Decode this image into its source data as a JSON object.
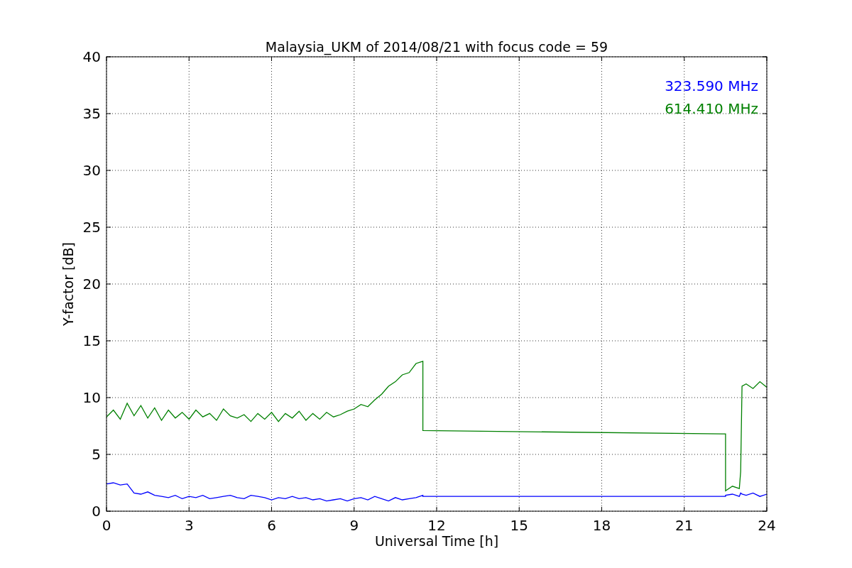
{
  "plot": {
    "chart_data": {
      "type": "line",
      "title": "Malaysia_UKM of 2014/08/21 with focus code = 59",
      "xlabel": "Universal Time [h]",
      "ylabel": "Y-factor [dB]",
      "x": [
        0,
        0.25,
        0.5,
        0.75,
        1,
        1.25,
        1.5,
        1.75,
        2,
        2.25,
        2.5,
        2.75,
        3,
        3.25,
        3.5,
        3.75,
        4,
        4.25,
        4.5,
        4.75,
        5,
        5.25,
        5.5,
        5.75,
        6,
        6.25,
        6.5,
        6.75,
        7,
        7.25,
        7.5,
        7.75,
        8,
        8.25,
        8.5,
        8.75,
        9,
        9.25,
        9.5,
        9.75,
        10,
        10.25,
        10.5,
        10.75,
        11,
        11.25,
        11.5,
        11.5,
        22.5,
        22.5,
        22.75,
        23,
        23.05,
        23.1,
        23.25,
        23.5,
        23.75,
        24
      ],
      "series": [
        {
          "name": "323.590 MHz",
          "color": "#0000ff",
          "values": [
            2.4,
            2.5,
            2.3,
            2.4,
            1.6,
            1.5,
            1.7,
            1.4,
            1.3,
            1.2,
            1.4,
            1.1,
            1.3,
            1.2,
            1.4,
            1.1,
            1.2,
            1.3,
            1.4,
            1.2,
            1.1,
            1.4,
            1.3,
            1.2,
            1.0,
            1.2,
            1.1,
            1.3,
            1.1,
            1.2,
            1.0,
            1.1,
            0.9,
            1.0,
            1.1,
            0.9,
            1.1,
            1.2,
            1.0,
            1.3,
            1.1,
            0.9,
            1.2,
            1.0,
            1.1,
            1.2,
            1.4,
            1.3,
            1.3,
            1.4,
            1.5,
            1.3,
            1.6,
            1.5,
            1.4,
            1.6,
            1.3,
            1.5
          ]
        },
        {
          "name": "614.410 MHz",
          "color": "#008000",
          "values": [
            8.3,
            8.9,
            8.1,
            9.5,
            8.4,
            9.3,
            8.2,
            9.1,
            8.0,
            8.9,
            8.2,
            8.7,
            8.1,
            8.9,
            8.3,
            8.6,
            8.0,
            9.0,
            8.4,
            8.2,
            8.5,
            7.9,
            8.6,
            8.1,
            8.7,
            7.9,
            8.6,
            8.2,
            8.8,
            8.0,
            8.6,
            8.1,
            8.7,
            8.3,
            8.5,
            8.8,
            9.0,
            9.4,
            9.2,
            9.8,
            10.3,
            11.0,
            11.4,
            12.0,
            12.2,
            13.0,
            13.2,
            7.1,
            6.8,
            1.8,
            2.2,
            2.0,
            3.5,
            11.0,
            11.2,
            10.8,
            11.4,
            10.9
          ]
        }
      ],
      "xlim": [
        0,
        24
      ],
      "ylim": [
        0,
        40
      ],
      "xticks": [
        0,
        3,
        6,
        9,
        12,
        15,
        18,
        21,
        24
      ],
      "yticks": [
        0,
        5,
        10,
        15,
        20,
        25,
        30,
        35,
        40
      ],
      "grid": true
    }
  }
}
